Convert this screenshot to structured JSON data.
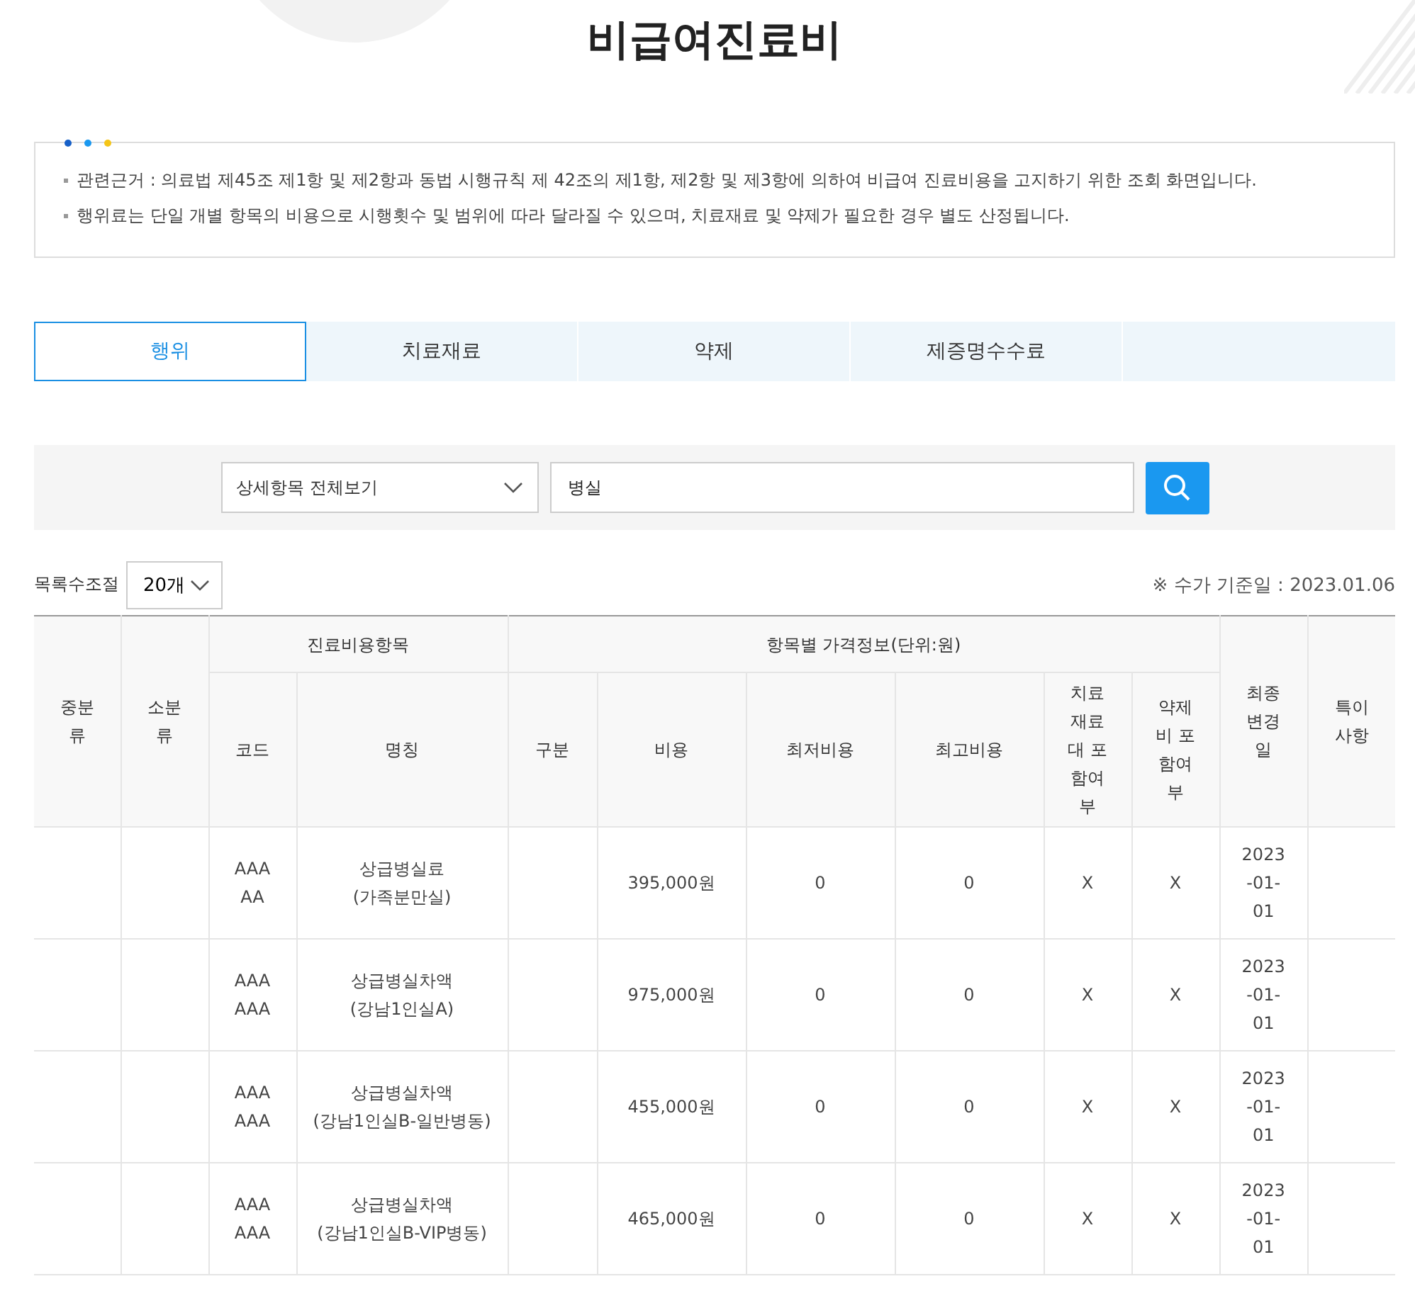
{
  "title": "비급여진료비",
  "notice": [
    "관련근거 : 의료법 제45조 제1항 및 제2항과 동법 시행규칙 제 42조의 제1항, 제2항 및 제3항에 의하여 비급여 진료비용을 고지하기 위한 조회 화면입니다.",
    "행위료는 단일 개별 항목의 비용으로 시행횟수 및 범위에 따라 달라질 수 있으며, 치료재료 및 약제가 필요한 경우 별도 산정됩니다."
  ],
  "tabs": [
    {
      "label": "행위",
      "selected": true
    },
    {
      "label": "치료재료",
      "selected": false
    },
    {
      "label": "약제",
      "selected": false
    },
    {
      "label": "제증명수수료",
      "selected": false
    }
  ],
  "search": {
    "category": "상세항목 전체보기",
    "query": "병실"
  },
  "page_size": {
    "label": "목록수조절",
    "value": "20개"
  },
  "base_date": "※ 수가 기준일 : 2023.01.06",
  "table": {
    "group_headers": [
      "진료비용항목",
      "항목별 가격정보(단위:원)"
    ],
    "columns": [
      "중분류",
      "소분류",
      "코드",
      "명칭",
      "구분",
      "비용",
      "최저비용",
      "최고비용",
      "치료재료대 포함여부",
      "약제비 포함여부",
      "최종변경일",
      "특이사항"
    ],
    "rows": [
      {
        "code": "AAAAA",
        "name": "상급병실료",
        "detail": "(가족분만실)",
        "cost": "395,000원",
        "min": "0",
        "max": "0",
        "material": "X",
        "drug": "X",
        "date": "2023-01-01"
      },
      {
        "code": "AAAAAA",
        "name": "상급병실차액",
        "detail": "(강남1인실A)",
        "cost": "975,000원",
        "min": "0",
        "max": "0",
        "material": "X",
        "drug": "X",
        "date": "2023-01-01"
      },
      {
        "code": "AAAAAA",
        "name": "상급병실차액",
        "detail": "(강남1인실B-일반병동)",
        "cost": "455,000원",
        "min": "0",
        "max": "0",
        "material": "X",
        "drug": "X",
        "date": "2023-01-01"
      },
      {
        "code": "AAAAAA",
        "name": "상급병실차액",
        "detail": "(강남1인실B-VIP병동)",
        "cost": "465,000원",
        "min": "0",
        "max": "0",
        "material": "X",
        "drug": "X",
        "date": "2023-01-01"
      }
    ]
  }
}
